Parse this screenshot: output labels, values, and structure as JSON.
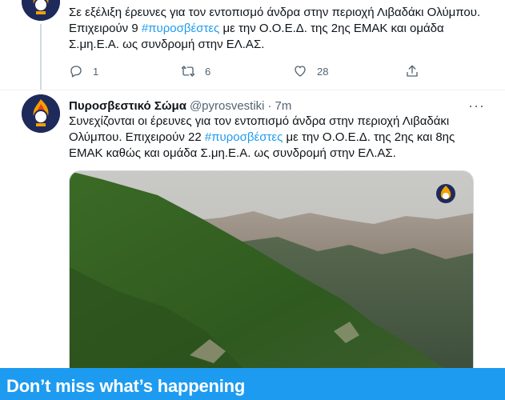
{
  "tweet1": {
    "text_before": "Σε εξέλιξη έρευνες για τον εντοπισμό άνδρα στην περιοχή Λιβαδάκι Ολύμπου. Επιχειρούν 9 ",
    "hashtag": "#πυροσβέστες",
    "text_after": " με την Ο.Ο.Ε.Δ. της 2ης ΕΜΑΚ και ομάδα Σ.μη.Ε.Α. ως συνδρομή στην ΕΛ.ΑΣ.",
    "replies": "1",
    "retweets": "6",
    "likes": "28"
  },
  "tweet2": {
    "name": "Πυροσβεστικό Σώμα",
    "handle": "@pyrosvestiki",
    "dot": "·",
    "time": "7m",
    "more": "···",
    "text_before": "Συνεχίζονται οι έρευνες για τον εντοπισμό άνδρα στην περιοχή Λιβαδάκι Ολύμπου. Επιχειρούν 22 ",
    "hashtag": "#πυροσβέστες",
    "text_after": " με την Ο.Ο.Ε.Δ. της 2ης και 8ης ΕΜΑΚ καθώς και ομάδα Σ.μη.Ε.Α. ως συνδρομή στην ΕΛ.ΑΣ."
  },
  "banner": {
    "title": "Don’t miss what’s happening"
  },
  "icons": {
    "reply": "reply-icon",
    "retweet": "retweet-icon",
    "like": "heart-icon",
    "share": "share-icon",
    "avatar": "fire-service-logo",
    "watermark": "fire-service-watermark"
  },
  "colors": {
    "link": "#1d9bf0",
    "banner": "#1d9bf0",
    "secondary_text": "#536471"
  }
}
